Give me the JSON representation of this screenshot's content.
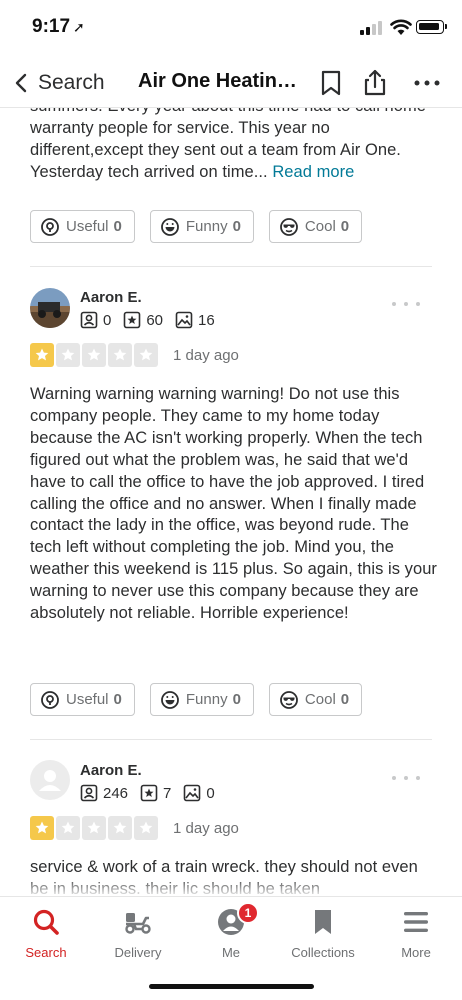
{
  "status": {
    "time": "9:17"
  },
  "nav": {
    "back_label": "Search",
    "title": "Air One Heating & Air"
  },
  "reviews": [
    {
      "text_tail": "summers. Every year about this time had to call home warranty people for service. This year no different,except they sent out a team from Air One. Yesterday  tech arrived on time...",
      "read_more": "Read more",
      "useful_label": "Useful",
      "useful_count": "0",
      "funny_label": "Funny",
      "funny_count": "0",
      "cool_label": "Cool",
      "cool_count": "0"
    },
    {
      "name": "Aaron E.",
      "friends": "0",
      "reviews": "60",
      "photos": "16",
      "rating": 1,
      "date": "1 day ago",
      "text": "Warning warning warning warning! Do not use this company people. They came to my home today because the AC isn't working properly. When the tech figured out what the problem was, he said that we'd have to call the office to have the job approved. I tired calling the office and no answer. When I finally made contact the lady in the office, was beyond rude. The tech left without completing the job. Mind you, the weather this weekend is 115 plus. So again, this is your warning to never use this company because they are absolutely not reliable. Horrible experience!",
      "useful_label": "Useful",
      "useful_count": "0",
      "funny_label": "Funny",
      "funny_count": "0",
      "cool_label": "Cool",
      "cool_count": "0"
    },
    {
      "name": "Aaron E.",
      "friends": "246",
      "reviews": "7",
      "photos": "0",
      "rating": 1,
      "date": "1 day ago",
      "text": "service & work of a train wreck.  they should not even be in business. their lic should be taken"
    }
  ],
  "tabs": [
    {
      "label": "Search",
      "icon": "search-icon",
      "active": true
    },
    {
      "label": "Delivery",
      "icon": "delivery-scooter-icon"
    },
    {
      "label": "Me",
      "icon": "user-icon",
      "badge": "1"
    },
    {
      "label": "Collections",
      "icon": "bookmark-icon"
    },
    {
      "label": "More",
      "icon": "menu-icon"
    }
  ],
  "colors": {
    "accent": "#d32323",
    "star": "#f5c84b",
    "link": "#027a97"
  }
}
